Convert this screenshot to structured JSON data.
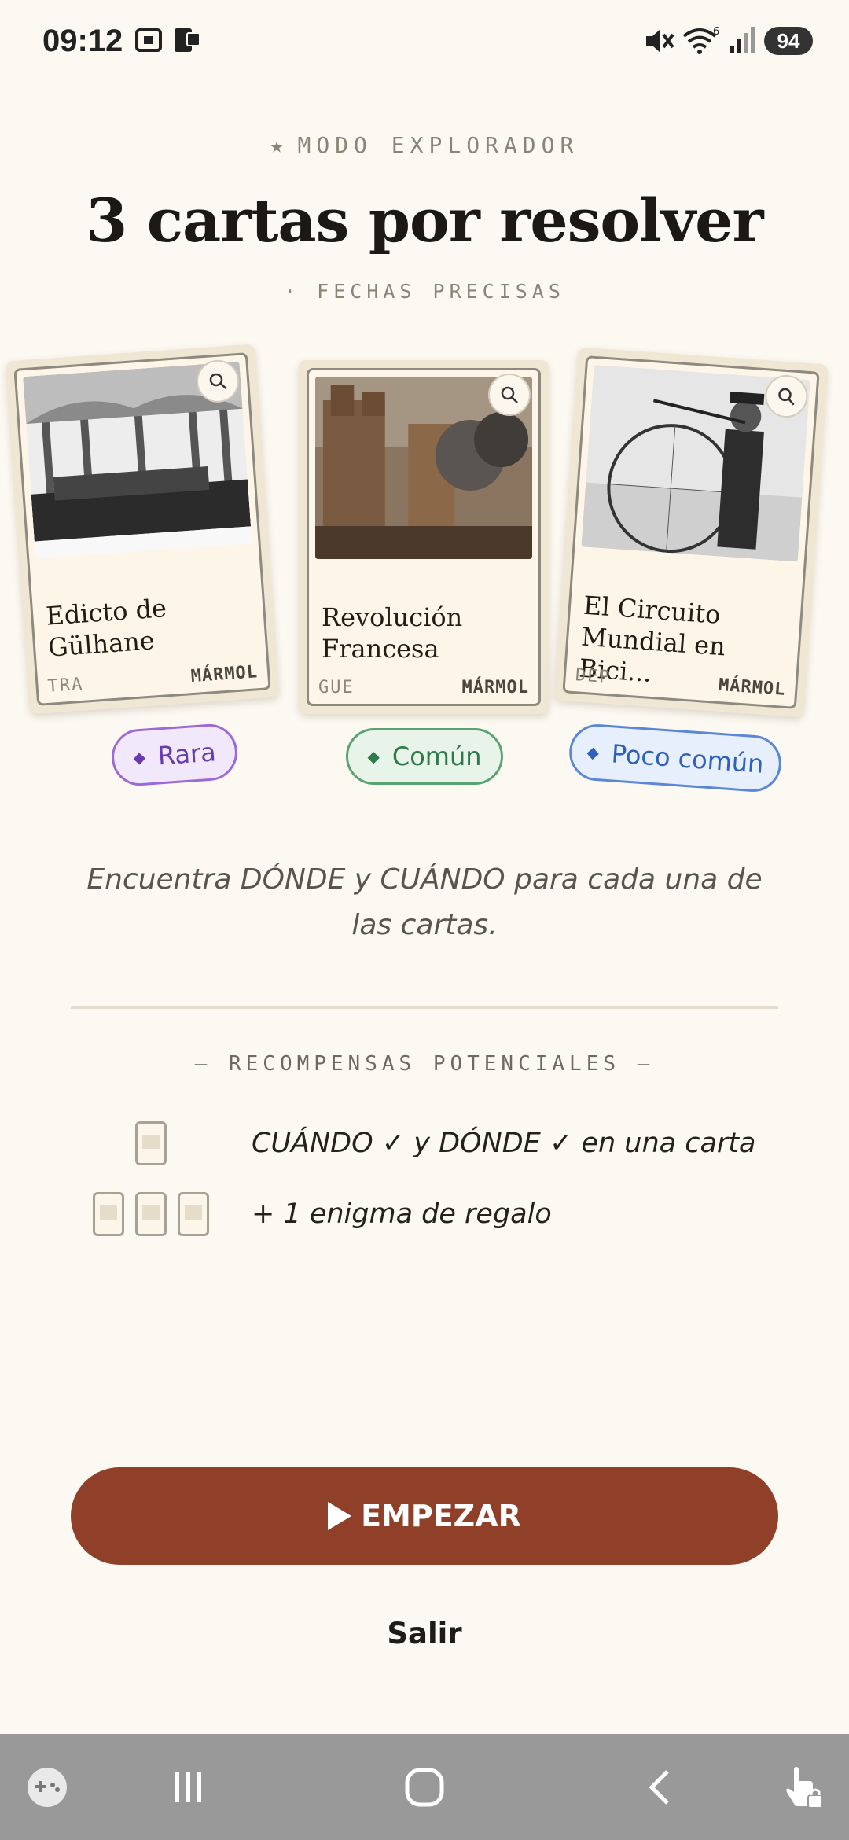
{
  "status_bar": {
    "time": "09:12",
    "battery": "94",
    "signal_badge": "6"
  },
  "header": {
    "eyebrow": "MODO EXPLORADOR",
    "title": "3 cartas por resolver",
    "subtitle": "· FECHAS PRECISAS"
  },
  "cards": [
    {
      "title": "Edicto de Gülhane",
      "code": "TRA",
      "material": "MÁRMOL",
      "rarity": "Rara",
      "image_desc": "engraving of a large ornate hall with assembled crowd"
    },
    {
      "title": "Revolución Francesa",
      "code": "GUE",
      "material": "MÁRMOL",
      "rarity": "Común",
      "image_desc": "painting of the storming of a fortress with smoke"
    },
    {
      "title": "El Circuito Mundial en Bici...",
      "code": "DEP",
      "material": "MÁRMOL",
      "rarity": "Poco común",
      "image_desc": "engraving of a man standing with a penny-farthing bicycle"
    }
  ],
  "colors": {
    "rara": "#7a44c2",
    "comun": "#3c8a55",
    "poco_comun": "#3d6fc7",
    "start_button": "#903f29"
  },
  "instructions": "Encuentra DÓNDE y CUÁNDO para cada una de las cartas.",
  "rewards": {
    "title": "— RECOMPENSAS POTENCIALES —",
    "items": [
      {
        "text": "CUÁNDO ✓ y DÓNDE ✓ en una carta"
      },
      {
        "text": "+ 1 enigma de regalo"
      }
    ]
  },
  "actions": {
    "start_label": "EMPEZAR",
    "exit_label": "Salir"
  },
  "nav_bar": {
    "icons": [
      "game-launcher-icon",
      "recent-apps-icon",
      "home-icon",
      "back-icon",
      "touch-lock-icon"
    ]
  }
}
